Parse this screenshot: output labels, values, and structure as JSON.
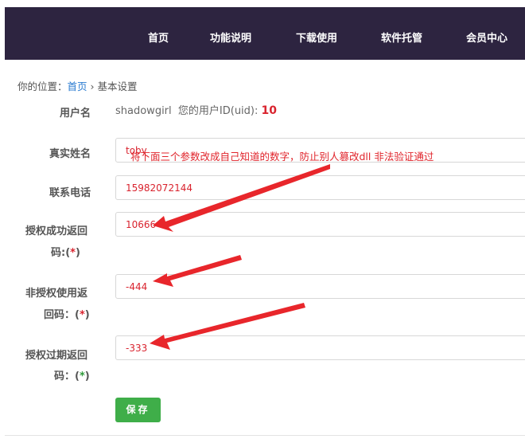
{
  "nav": {
    "items": [
      "首页",
      "功能说明",
      "下载使用",
      "软件托管",
      "会员中心"
    ]
  },
  "breadcrumb": {
    "prefix": "你的位置：",
    "home": "首页",
    "separator": " › ",
    "current": "基本设置"
  },
  "form": {
    "username_label": "用户名",
    "username_value": "shadowgirl",
    "uid_text": "您的用户ID(uid):",
    "uid_value": "10",
    "realname_label": "真实姓名",
    "realname_value": "toby",
    "phone_label": "联系电话",
    "phone_value": "15982072144",
    "success_code_label_1": "授权成功返回",
    "success_code_label_2": "码:",
    "success_code_value": "10666",
    "unauth_code_label_1": "非授权使用返",
    "unauth_code_label_2": "回码：",
    "unauth_code_value": "-444",
    "expired_code_label_1": "授权过期返回",
    "expired_code_label_2": "码：",
    "expired_code_value": "-333",
    "required_open": "(",
    "required_star": "*",
    "required_close": ")",
    "save_label": "保存"
  },
  "annotation": {
    "text": "将下面三个参数改成自己知道的数字，防止别人篡改dll 非法验证通过"
  },
  "colors": {
    "topbar": "#2d2440",
    "link": "#2a7bd0",
    "accent_red": "#d9232e",
    "save_button": "#3fae49"
  }
}
